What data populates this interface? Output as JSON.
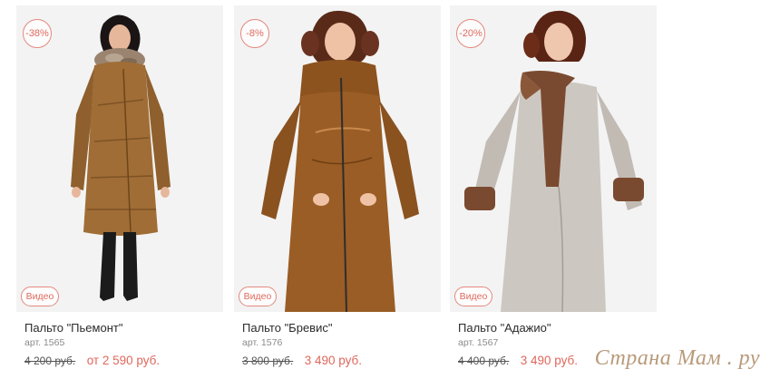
{
  "products": [
    {
      "discount": "-38%",
      "video": "Видео",
      "name": "Пальто \"Пьемонт\"",
      "sku": "арт. 1565",
      "old_price": "4 200 руб.",
      "new_price": "от 2 590 руб.",
      "coat_color": "#a06d36",
      "fur_color": "#9a8470"
    },
    {
      "discount": "-8%",
      "video": "Видео",
      "name": "Пальто \"Бревис\"",
      "sku": "арт. 1576",
      "old_price": "3 800 руб.",
      "new_price": "3 490 руб.",
      "coat_color": "#9a5d25",
      "fur_color": ""
    },
    {
      "discount": "-20%",
      "video": "Видео",
      "name": "Пальто \"Адажио\"",
      "sku": "арт. 1567",
      "old_price": "4 400 руб.",
      "new_price": "3 490 руб.",
      "coat_color": "#cdc7c1",
      "fur_color": "#7a4a30"
    }
  ],
  "watermark": "Страна Мам . ру",
  "colors": {
    "accent": "#e0675b",
    "badge_border": "#e4887e"
  }
}
